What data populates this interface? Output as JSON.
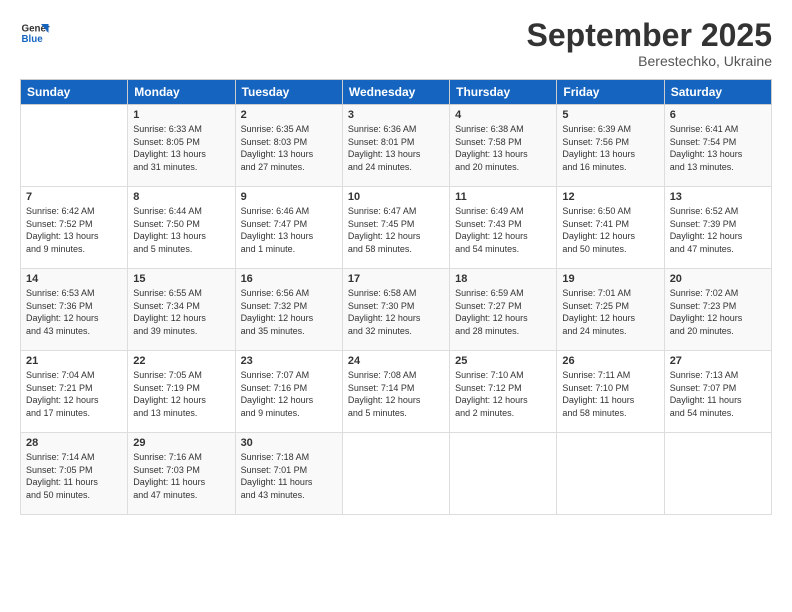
{
  "logo": {
    "line1": "General",
    "line2": "Blue"
  },
  "title": "September 2025",
  "subtitle": "Berestechko, Ukraine",
  "header": {
    "days": [
      "Sunday",
      "Monday",
      "Tuesday",
      "Wednesday",
      "Thursday",
      "Friday",
      "Saturday"
    ]
  },
  "weeks": [
    [
      {
        "day": "",
        "info": ""
      },
      {
        "day": "1",
        "info": "Sunrise: 6:33 AM\nSunset: 8:05 PM\nDaylight: 13 hours\nand 31 minutes."
      },
      {
        "day": "2",
        "info": "Sunrise: 6:35 AM\nSunset: 8:03 PM\nDaylight: 13 hours\nand 27 minutes."
      },
      {
        "day": "3",
        "info": "Sunrise: 6:36 AM\nSunset: 8:01 PM\nDaylight: 13 hours\nand 24 minutes."
      },
      {
        "day": "4",
        "info": "Sunrise: 6:38 AM\nSunset: 7:58 PM\nDaylight: 13 hours\nand 20 minutes."
      },
      {
        "day": "5",
        "info": "Sunrise: 6:39 AM\nSunset: 7:56 PM\nDaylight: 13 hours\nand 16 minutes."
      },
      {
        "day": "6",
        "info": "Sunrise: 6:41 AM\nSunset: 7:54 PM\nDaylight: 13 hours\nand 13 minutes."
      }
    ],
    [
      {
        "day": "7",
        "info": "Sunrise: 6:42 AM\nSunset: 7:52 PM\nDaylight: 13 hours\nand 9 minutes."
      },
      {
        "day": "8",
        "info": "Sunrise: 6:44 AM\nSunset: 7:50 PM\nDaylight: 13 hours\nand 5 minutes."
      },
      {
        "day": "9",
        "info": "Sunrise: 6:46 AM\nSunset: 7:47 PM\nDaylight: 13 hours\nand 1 minute."
      },
      {
        "day": "10",
        "info": "Sunrise: 6:47 AM\nSunset: 7:45 PM\nDaylight: 12 hours\nand 58 minutes."
      },
      {
        "day": "11",
        "info": "Sunrise: 6:49 AM\nSunset: 7:43 PM\nDaylight: 12 hours\nand 54 minutes."
      },
      {
        "day": "12",
        "info": "Sunrise: 6:50 AM\nSunset: 7:41 PM\nDaylight: 12 hours\nand 50 minutes."
      },
      {
        "day": "13",
        "info": "Sunrise: 6:52 AM\nSunset: 7:39 PM\nDaylight: 12 hours\nand 47 minutes."
      }
    ],
    [
      {
        "day": "14",
        "info": "Sunrise: 6:53 AM\nSunset: 7:36 PM\nDaylight: 12 hours\nand 43 minutes."
      },
      {
        "day": "15",
        "info": "Sunrise: 6:55 AM\nSunset: 7:34 PM\nDaylight: 12 hours\nand 39 minutes."
      },
      {
        "day": "16",
        "info": "Sunrise: 6:56 AM\nSunset: 7:32 PM\nDaylight: 12 hours\nand 35 minutes."
      },
      {
        "day": "17",
        "info": "Sunrise: 6:58 AM\nSunset: 7:30 PM\nDaylight: 12 hours\nand 32 minutes."
      },
      {
        "day": "18",
        "info": "Sunrise: 6:59 AM\nSunset: 7:27 PM\nDaylight: 12 hours\nand 28 minutes."
      },
      {
        "day": "19",
        "info": "Sunrise: 7:01 AM\nSunset: 7:25 PM\nDaylight: 12 hours\nand 24 minutes."
      },
      {
        "day": "20",
        "info": "Sunrise: 7:02 AM\nSunset: 7:23 PM\nDaylight: 12 hours\nand 20 minutes."
      }
    ],
    [
      {
        "day": "21",
        "info": "Sunrise: 7:04 AM\nSunset: 7:21 PM\nDaylight: 12 hours\nand 17 minutes."
      },
      {
        "day": "22",
        "info": "Sunrise: 7:05 AM\nSunset: 7:19 PM\nDaylight: 12 hours\nand 13 minutes."
      },
      {
        "day": "23",
        "info": "Sunrise: 7:07 AM\nSunset: 7:16 PM\nDaylight: 12 hours\nand 9 minutes."
      },
      {
        "day": "24",
        "info": "Sunrise: 7:08 AM\nSunset: 7:14 PM\nDaylight: 12 hours\nand 5 minutes."
      },
      {
        "day": "25",
        "info": "Sunrise: 7:10 AM\nSunset: 7:12 PM\nDaylight: 12 hours\nand 2 minutes."
      },
      {
        "day": "26",
        "info": "Sunrise: 7:11 AM\nSunset: 7:10 PM\nDaylight: 11 hours\nand 58 minutes."
      },
      {
        "day": "27",
        "info": "Sunrise: 7:13 AM\nSunset: 7:07 PM\nDaylight: 11 hours\nand 54 minutes."
      }
    ],
    [
      {
        "day": "28",
        "info": "Sunrise: 7:14 AM\nSunset: 7:05 PM\nDaylight: 11 hours\nand 50 minutes."
      },
      {
        "day": "29",
        "info": "Sunrise: 7:16 AM\nSunset: 7:03 PM\nDaylight: 11 hours\nand 47 minutes."
      },
      {
        "day": "30",
        "info": "Sunrise: 7:18 AM\nSunset: 7:01 PM\nDaylight: 11 hours\nand 43 minutes."
      },
      {
        "day": "",
        "info": ""
      },
      {
        "day": "",
        "info": ""
      },
      {
        "day": "",
        "info": ""
      },
      {
        "day": "",
        "info": ""
      }
    ]
  ]
}
